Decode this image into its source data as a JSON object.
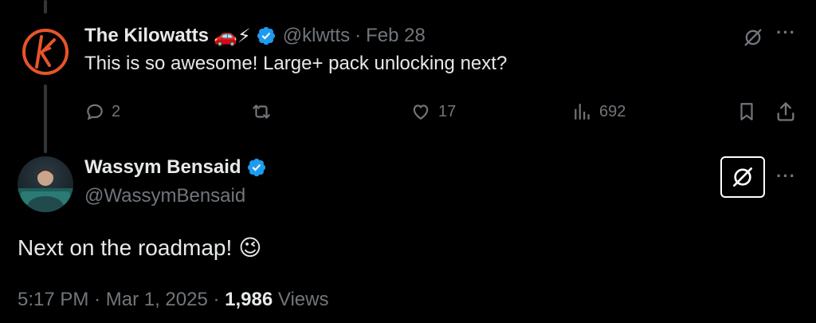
{
  "reply": {
    "author_name": "The Kilowatts",
    "emojis": "🚗⚡",
    "handle": "@klwtts",
    "separator": "·",
    "date": "Feb 28",
    "text": "This is so awesome! Large+ pack unlocking next?",
    "stats": {
      "replies": "2",
      "reposts": "",
      "likes": "17",
      "views": "692"
    }
  },
  "main_tweet": {
    "author_name": "Wassym Bensaid",
    "handle": "@WassymBensaid",
    "text": "Next on the roadmap!",
    "emoji": "😉",
    "time": "5:17 PM",
    "separator": "·",
    "date": "Mar 1, 2025",
    "separator2": "·",
    "views_count": "1,986",
    "views_label": "Views"
  },
  "icons": {
    "more": "···"
  },
  "colors": {
    "background": "#000000",
    "text_primary": "#e7e9ea",
    "text_secondary": "#71767b",
    "verified_blue": "#1d9bf0",
    "brand_orange": "#e8542a"
  }
}
